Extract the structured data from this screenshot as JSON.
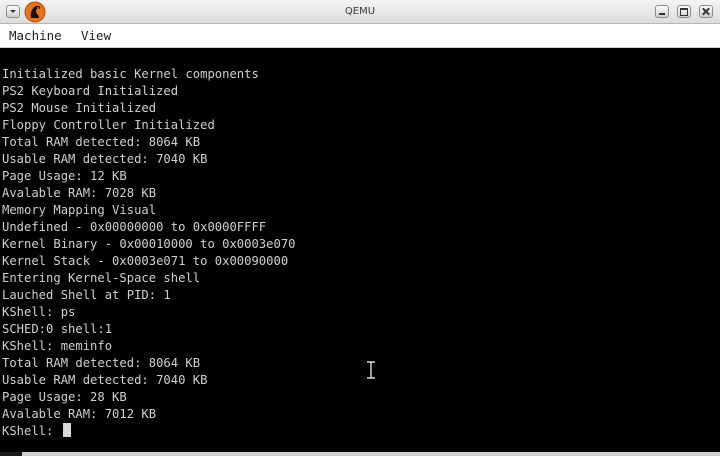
{
  "window": {
    "title": "QEMU"
  },
  "menubar": {
    "items": [
      "Machine",
      "View"
    ]
  },
  "console": {
    "lines": [
      "",
      "Initialized basic Kernel components",
      "PS2 Keyboard Initialized",
      "PS2 Mouse Initialized",
      "Floppy Controller Initialized",
      "Total RAM detected: 8064 KB",
      "Usable RAM detected: 7040 KB",
      "Page Usage: 12 KB",
      "Avalable RAM: 7028 KB",
      "Memory Mapping Visual",
      "Undefined - 0x00000000 to 0x0000FFFF",
      "Kernel Binary - 0x00010000 to 0x0003e070",
      "Kernel Stack - 0x0003e071 to 0x00090000",
      "Entering Kernel-Space shell",
      "Lauched Shell at PID: 1",
      "KShell: ps",
      "SCHED:0 shell:1",
      "KShell: meminfo",
      "Total RAM detected: 8064 KB",
      "Usable RAM detected: 7040 KB",
      "Page Usage: 28 KB",
      "Avalable RAM: 7012 KB"
    ],
    "prompt": "KShell: "
  },
  "icons": {
    "window_menu": "window-menu-icon",
    "app_logo": "qemu-logo-icon",
    "minimize": "minimize-icon",
    "maximize": "maximize-icon",
    "close": "close-icon",
    "mouse": "ibeam-cursor-icon"
  },
  "colors": {
    "console_bg": "#000000",
    "console_text": "#cfcfcf",
    "logo_orange": "#e8731a"
  }
}
